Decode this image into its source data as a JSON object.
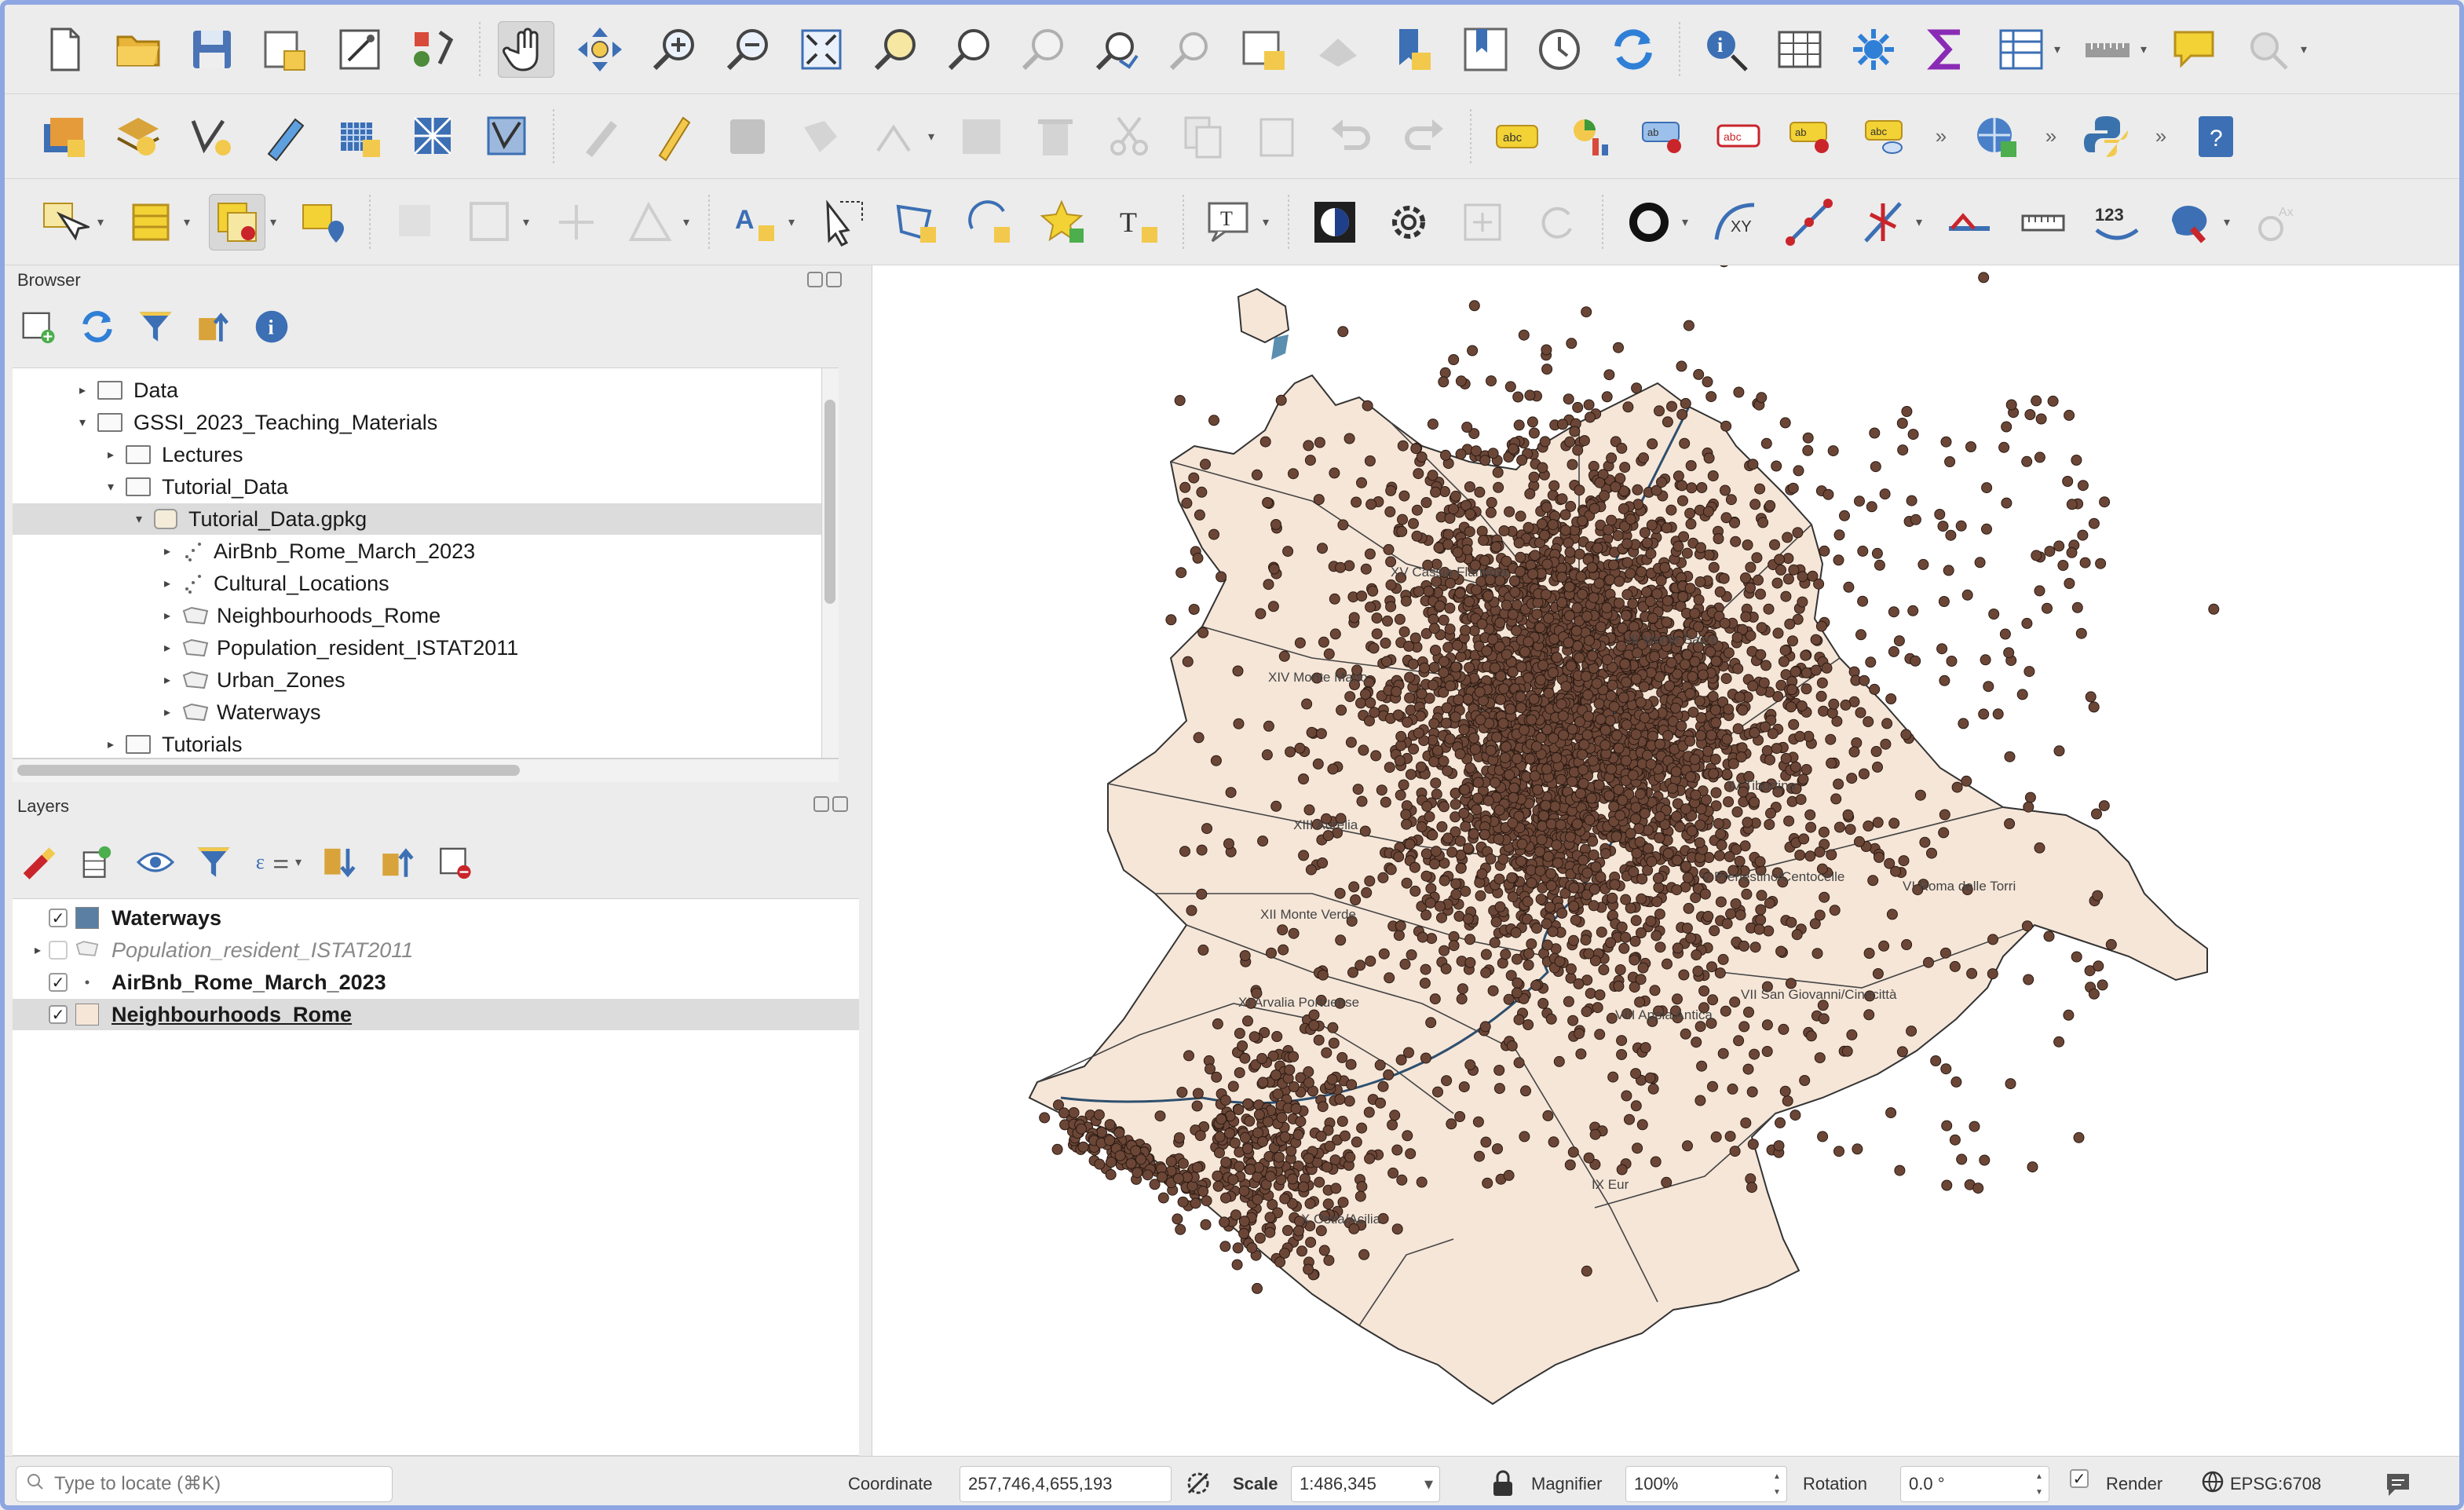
{
  "toolbar1": {
    "icons": [
      "new-project-icon",
      "open-project-icon",
      "save-project-icon",
      "save-as-icon",
      "print-layout-icon",
      "style-manager-icon",
      "pan-map-icon",
      "pan-to-selection-icon",
      "zoom-in-icon",
      "zoom-out-icon",
      "zoom-full-icon",
      "zoom-to-selection-icon",
      "zoom-to-layer-icon",
      "zoom-native-icon",
      "zoom-last-icon",
      "zoom-next-icon",
      "new-map-view-icon",
      "new-3d-view-icon",
      "new-bookmark-icon",
      "show-bookmarks-icon",
      "temporal-controller-icon",
      "refresh-icon",
      "identify-icon",
      "attribute-table-icon",
      "statistics-icon",
      "sum-icon",
      "field-calculator-icon",
      "measure-icon",
      "map-tips-icon",
      "locator-icon"
    ]
  },
  "toolbar2": {
    "icons": [
      "data-source-manager-icon",
      "add-layer-icon",
      "add-vector-icon",
      "digitize-icon",
      "add-raster-icon",
      "add-mesh-icon",
      "add-vector-tile-icon",
      "current-edits-icon",
      "toggle-editing-icon",
      "save-edits-icon",
      "add-feature-icon",
      "vertex-tool-icon",
      "modify-attributes-icon",
      "delete-selected-icon",
      "cut-features-icon",
      "copy-features-icon",
      "paste-features-icon",
      "undo-icon",
      "redo-icon",
      "label-icon",
      "diagram-icon",
      "pin-label-icon",
      "show-hide-labels-icon",
      "move-label-icon",
      "rotate-label-icon",
      "change-label-icon",
      "plugins-icon",
      "python-icon",
      "help-icon"
    ]
  },
  "toolbar3": {
    "icons": [
      "select-features-icon",
      "open-table-icon",
      "deselect-icon",
      "select-location-icon",
      "advanced-digitizing-icon",
      "cad-icon",
      "split-icon",
      "merge-icon",
      "annotation-icon",
      "select-by-area-icon",
      "add-polygon-icon",
      "add-circle-icon",
      "add-star-icon",
      "add-text-icon",
      "text-annotation-icon",
      "mask-icon",
      "settings-icon",
      "plus-icon",
      "reload-icon",
      "ring-icon",
      "xy-icon",
      "line-icon",
      "snap-icon",
      "reshape-icon",
      "ruler-icon",
      "label-123-icon",
      "color-icon",
      "gear-icon"
    ]
  },
  "browser": {
    "title": "Browser",
    "tree": [
      {
        "label": "Data",
        "depth": 0,
        "expanded": false,
        "type": "folder"
      },
      {
        "label": "GSSI_2023_Teaching_Materials",
        "depth": 0,
        "expanded": true,
        "type": "folder"
      },
      {
        "label": "Lectures",
        "depth": 1,
        "expanded": false,
        "type": "folder"
      },
      {
        "label": "Tutorial_Data",
        "depth": 1,
        "expanded": true,
        "type": "folder"
      },
      {
        "label": "Tutorial_Data.gpkg",
        "depth": 2,
        "expanded": true,
        "type": "gpkg"
      },
      {
        "label": "AirBnb_Rome_March_2023",
        "depth": 3,
        "expanded": false,
        "type": "points"
      },
      {
        "label": "Cultural_Locations",
        "depth": 3,
        "expanded": false,
        "type": "points"
      },
      {
        "label": "Neighbourhoods_Rome",
        "depth": 3,
        "expanded": false,
        "type": "polygon"
      },
      {
        "label": "Population_resident_ISTAT2011",
        "depth": 3,
        "expanded": false,
        "type": "polygon"
      },
      {
        "label": "Urban_Zones",
        "depth": 3,
        "expanded": false,
        "type": "polygon"
      },
      {
        "label": "Waterways",
        "depth": 3,
        "expanded": false,
        "type": "polygon"
      },
      {
        "label": "Tutorials",
        "depth": 1,
        "expanded": false,
        "type": "folder"
      }
    ]
  },
  "layers": {
    "title": "Layers",
    "items": [
      {
        "label": "Waterways",
        "checked": true,
        "style": "normal",
        "swatch": "#5b7fa3"
      },
      {
        "label": "Population_resident_ISTAT2011",
        "checked": false,
        "style": "italic",
        "swatch": "none"
      },
      {
        "label": "AirBnb_Rome_March_2023",
        "checked": true,
        "style": "normal",
        "swatch": "point"
      },
      {
        "label": "Neighbourhoods_Rome",
        "checked": true,
        "style": "bold-underline",
        "swatch": "#f6e6d8"
      }
    ]
  },
  "map": {
    "fill_color": "#f6e6d8",
    "point_color": "#6b4637",
    "water_color": "#5b8fb0",
    "labels": [
      "XV Cassia Flaminia",
      "III Monte Sacro",
      "XIV Monte Mario",
      "XIII Aurelia",
      "IV Tiburtina",
      "V Prenestino/Centocelle",
      "VI Roma delle Torri",
      "XII Monte Verde",
      "XI Arvalia Portuense",
      "VII San Giovanni/Cinecittà",
      "VIII Appia Antica",
      "IX Eur",
      "X Ostia/Acilia"
    ]
  },
  "status": {
    "locate_placeholder": "Type to locate (⌘K)",
    "coordinate_label": "Coordinate",
    "coordinate_value": "257,746,4,655,193",
    "scale_label": "Scale",
    "scale_value": "1:486,345",
    "magnifier_label": "Magnifier",
    "magnifier_value": "100%",
    "rotation_label": "Rotation",
    "rotation_value": "0.0 °",
    "render_label": "Render",
    "render_checked": true,
    "crs_value": "EPSG:6708"
  }
}
